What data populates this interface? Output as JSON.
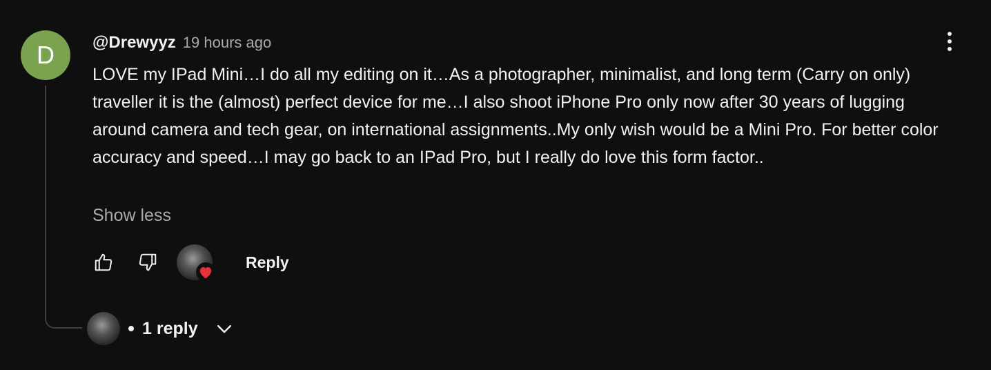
{
  "comment": {
    "avatar_letter": "D",
    "avatar_color": "#7ba34f",
    "author": "@Drewyyz",
    "timestamp": "19 hours ago",
    "text": "LOVE my IPad Mini…I do all my editing on it…As a photographer, minimalist, and long term (Carry on only) traveller it is the (almost) perfect device for me…I also shoot iPhone Pro only now after 30 years of lugging around camera and tech gear, on international assignments..My only wish would be a Mini Pro. For better color accuracy and speed…I may go back to an IPad Pro, but I really do love this form factor..",
    "show_less_label": "Show less",
    "menu_icon": "more-vertical-icon"
  },
  "actions": {
    "like_icon": "thumbs-up-icon",
    "dislike_icon": "thumbs-down-icon",
    "creator_heart_icon": "heart-icon",
    "heart_color": "#e8313b",
    "reply_label": "Reply"
  },
  "replies": {
    "count_label": "1 reply",
    "toggle_icon": "chevron-down-icon"
  }
}
